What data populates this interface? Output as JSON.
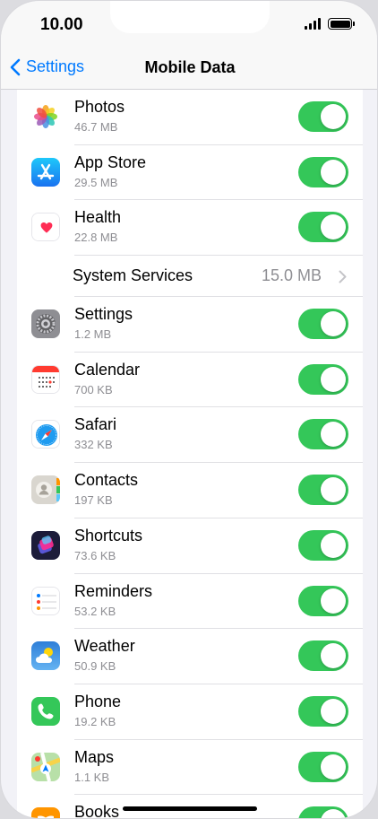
{
  "status_bar": {
    "time": "10.00"
  },
  "nav": {
    "back_label": "Settings",
    "title": "Mobile Data"
  },
  "colors": {
    "accent": "#007aff",
    "toggle_on": "#34c759"
  },
  "apps": [
    {
      "name": "Photos",
      "size": "46.7 MB",
      "icon": "photos-icon",
      "enabled": true
    },
    {
      "name": "App Store",
      "size": "29.5 MB",
      "icon": "app-store-icon",
      "enabled": true
    },
    {
      "name": "Health",
      "size": "22.8 MB",
      "icon": "health-icon",
      "enabled": true
    }
  ],
  "system_services": {
    "label": "System Services",
    "value": "15.0 MB"
  },
  "apps_more": [
    {
      "name": "Settings",
      "size": "1.2 MB",
      "icon": "settings-icon",
      "enabled": true
    },
    {
      "name": "Calendar",
      "size": "700 KB",
      "icon": "calendar-icon",
      "enabled": true
    },
    {
      "name": "Safari",
      "size": "332 KB",
      "icon": "safari-icon",
      "enabled": true
    },
    {
      "name": "Contacts",
      "size": "197 KB",
      "icon": "contacts-icon",
      "enabled": true
    },
    {
      "name": "Shortcuts",
      "size": "73.6 KB",
      "icon": "shortcuts-icon",
      "enabled": true
    },
    {
      "name": "Reminders",
      "size": "53.2 KB",
      "icon": "reminders-icon",
      "enabled": true
    },
    {
      "name": "Weather",
      "size": "50.9 KB",
      "icon": "weather-icon",
      "enabled": true
    },
    {
      "name": "Phone",
      "size": "19.2 KB",
      "icon": "phone-icon",
      "enabled": true
    },
    {
      "name": "Maps",
      "size": "1.1 KB",
      "icon": "maps-icon",
      "enabled": true
    },
    {
      "name": "Books",
      "size": "",
      "icon": "books-icon",
      "enabled": true
    }
  ]
}
